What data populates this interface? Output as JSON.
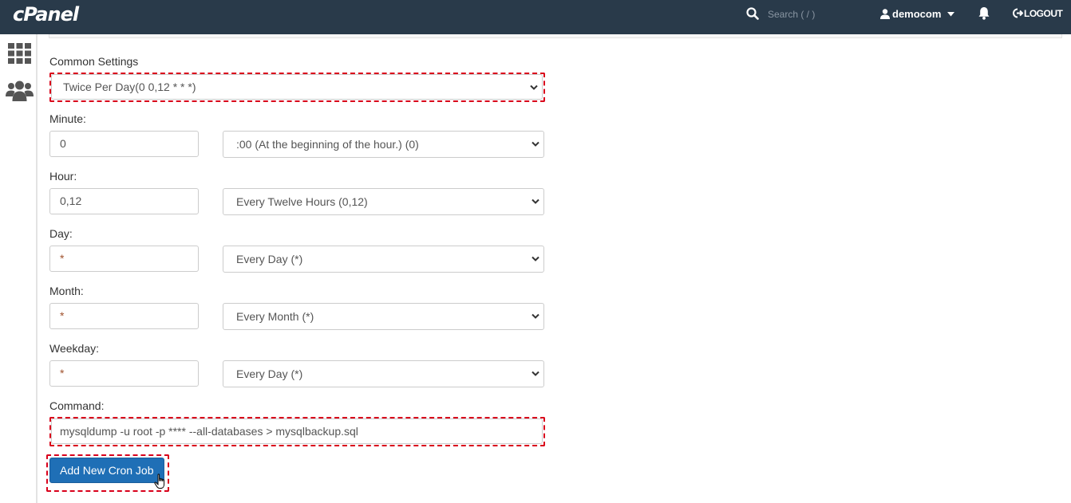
{
  "header": {
    "logo_text": "cPanel",
    "search_placeholder": "Search ( / )",
    "user_name": "democom",
    "logout_label": "LOGOUT",
    "icons": [
      "search-icon",
      "user-icon",
      "caret-down-icon",
      "bell-icon",
      "logout-icon"
    ]
  },
  "sidebar": {
    "icons": [
      "grid-icon",
      "users-icon"
    ]
  },
  "form": {
    "common_settings": {
      "label": "Common Settings",
      "value": "Twice Per Day(0 0,12 * * *)"
    },
    "minute": {
      "label": "Minute:",
      "value": "0",
      "option": ":00 (At the beginning of the hour.) (0)"
    },
    "hour": {
      "label": "Hour:",
      "value": "0,12",
      "option": "Every Twelve Hours (0,12)"
    },
    "day": {
      "label": "Day:",
      "value": "*",
      "option": "Every Day (*)"
    },
    "month": {
      "label": "Month:",
      "value": "*",
      "option": "Every Month (*)"
    },
    "weekday": {
      "label": "Weekday:",
      "value": "*",
      "option": "Every Day (*)"
    },
    "command": {
      "label": "Command:",
      "value": "mysqldump -u root -p **** --all-databases > mysqlbackup.sql"
    },
    "submit_label": "Add New Cron Job"
  },
  "colors": {
    "topbar": "#293a4a",
    "button": "#1f6fb6",
    "highlight": "#d9001b"
  }
}
